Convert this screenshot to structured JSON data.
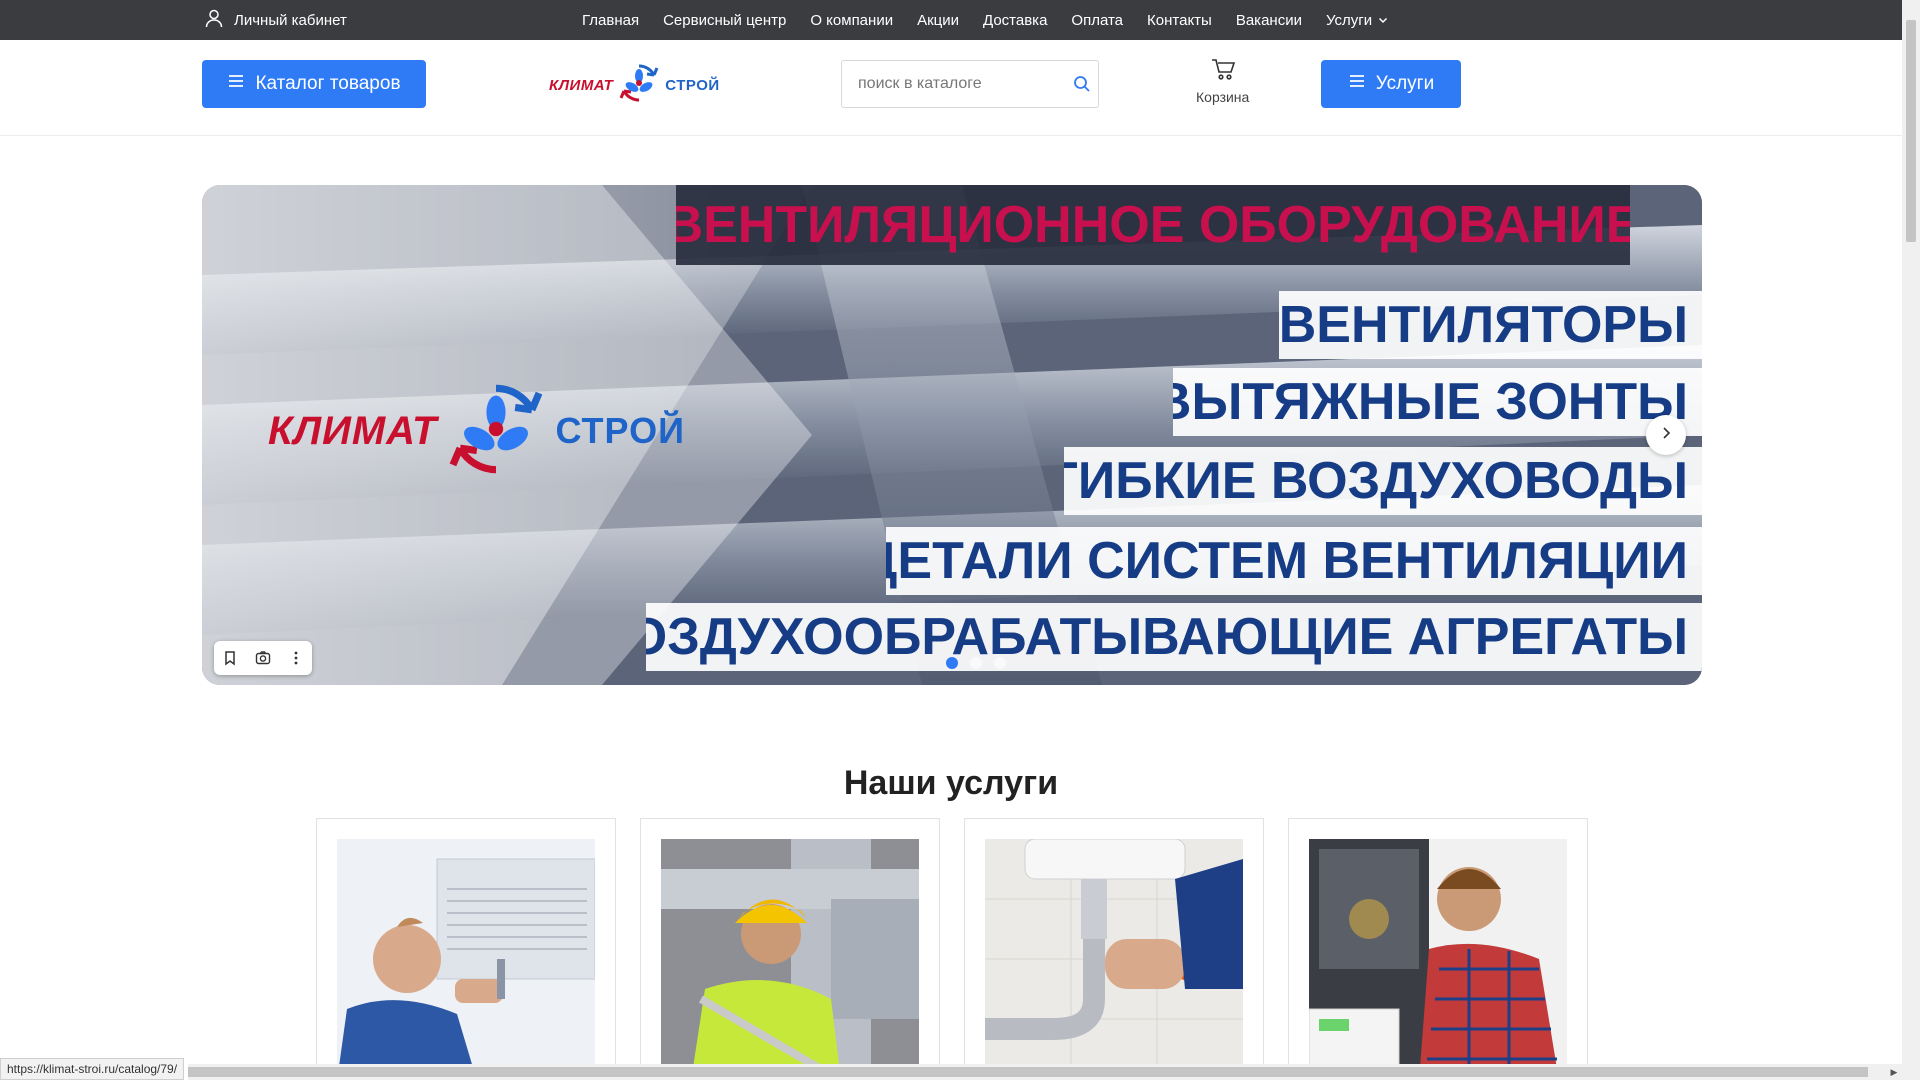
{
  "topbar": {
    "account_label": "Личный кабинет",
    "nav": [
      "Главная",
      "Сервисный центр",
      "О компании",
      "Акции",
      "Доставка",
      "Оплата",
      "Контакты",
      "Вакансии",
      "Услуги"
    ]
  },
  "header": {
    "catalog_button": "Каталог товаров",
    "logo_left": "КЛИМАТ",
    "logo_right": "СТРОЙ",
    "search_placeholder": "поиск в каталоге",
    "cart_label": "Корзина",
    "services_button": "Услуги"
  },
  "banner": {
    "title": "ВЕНТИЛЯЦИОННОЕ ОБОРУДОВАНИЕ",
    "lines": [
      "ВЕНТИЛЯТОРЫ",
      "ВЫТЯЖНЫЕ ЗОНТЫ",
      "ГИБКИЕ ВОЗДУХОВОДЫ",
      "ДЕТАЛИ СИСТЕМ ВЕНТИЛЯЦИИ",
      "ВОЗДУХООБРАБАТЫВАЮЩИЕ АГРЕГАТЫ"
    ],
    "logo_left": "КЛИМАТ",
    "logo_right": "СТРОЙ",
    "slide_count": 3,
    "active_slide": 1
  },
  "services": {
    "title": "Наши услуги",
    "cards": [
      {
        "image": "air-conditioner-repair-photo"
      },
      {
        "image": "ventilation-installation-photo"
      },
      {
        "image": "plumbing-repair-photo"
      },
      {
        "image": "boiler-service-photo"
      }
    ]
  },
  "status": {
    "url": "https://klimat-stroi.ru/catalog/79/"
  },
  "colors": {
    "topbar": "#3a3c40",
    "accent_blue": "#2f7bf5",
    "logo_red": "#c8102e",
    "logo_blue": "#1f64c8",
    "banner_title": "#c8104f",
    "banner_text": "#163c86"
  }
}
